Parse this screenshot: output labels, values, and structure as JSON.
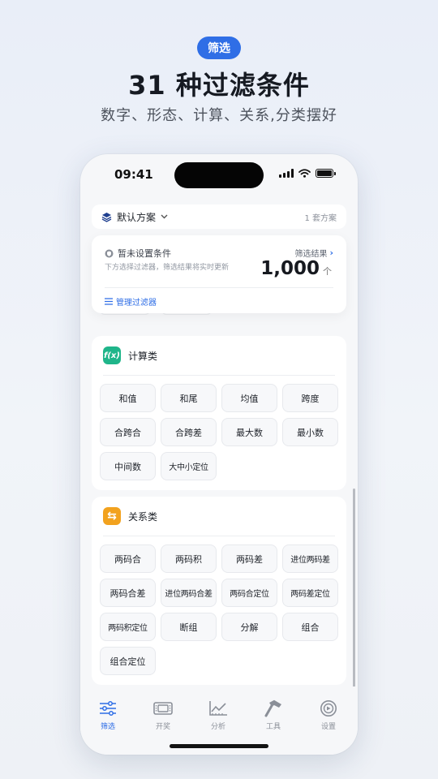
{
  "hero": {
    "badge": "筛选",
    "title": "31 种过滤条件",
    "subtitle": "数字、形态、计算、关系,分类摆好"
  },
  "status": {
    "time": "09:41"
  },
  "scheme": {
    "name": "默认方案",
    "count": "1 套方案"
  },
  "conditions": {
    "title": "暂未设置条件",
    "hint": "下方选择过滤器，筛选结果将实时更新",
    "result_label": "筛选结果",
    "result_value": "1,000",
    "result_unit": "个",
    "manage_label": "管理过滤器"
  },
  "sections": {
    "calc": {
      "icon_text": "f(x)",
      "title": "计算类",
      "color": "#1fb58a",
      "chips": [
        "和值",
        "和尾",
        "均值",
        "跨度",
        "合跨合",
        "合跨差",
        "最大数",
        "最小数",
        "中间数",
        "大中小定位"
      ]
    },
    "relation": {
      "icon_text": "⇆",
      "title": "关系类",
      "color": "#f2a21e",
      "chips": [
        "两码合",
        "两码积",
        "两码差",
        "进位两码差",
        "两码合差",
        "进位两码合差",
        "两码合定位",
        "两码差定位",
        "两码积定位",
        "断组",
        "分解",
        "组合",
        "组合定位"
      ]
    }
  },
  "tabs": [
    {
      "label": "筛选",
      "icon": "sliders-icon",
      "active": true
    },
    {
      "label": "开奖",
      "icon": "ticket-icon",
      "active": false
    },
    {
      "label": "分析",
      "icon": "chart-icon",
      "active": false
    },
    {
      "label": "工具",
      "icon": "hammer-icon",
      "active": false
    },
    {
      "label": "设置",
      "icon": "gear-icon",
      "active": false
    }
  ],
  "colors": {
    "accent": "#2f6ee6"
  }
}
